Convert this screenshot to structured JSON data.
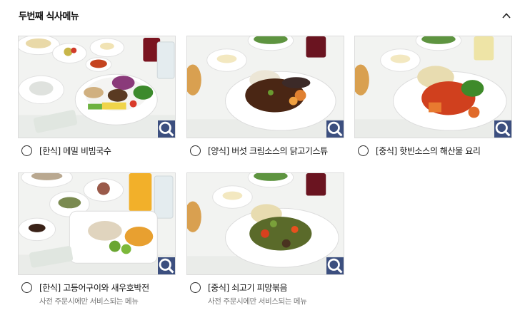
{
  "section": {
    "title": "두번째 식사메뉴",
    "collapse_icon": "chevron-up-icon"
  },
  "zoom_icon": "magnifier-icon",
  "menu_items": [
    {
      "label": "[한식] 메밀 비빔국수",
      "note": ""
    },
    {
      "label": "[양식] 버섯 크림소스의 닭고기스튜",
      "note": ""
    },
    {
      "label": "[중식] 핫빈소스의 해산물 요리",
      "note": ""
    },
    {
      "label": "[한식] 고등어구이와 새우호박전",
      "note": "사전 주문시에만 서비스되는 메뉴"
    },
    {
      "label": "[중식] 쇠고기 피망볶음",
      "note": "사전 주문시에만 서비스되는 메뉴"
    }
  ],
  "colors": {
    "zoom_button": "#3c4f7f",
    "note_text": "#777777"
  }
}
